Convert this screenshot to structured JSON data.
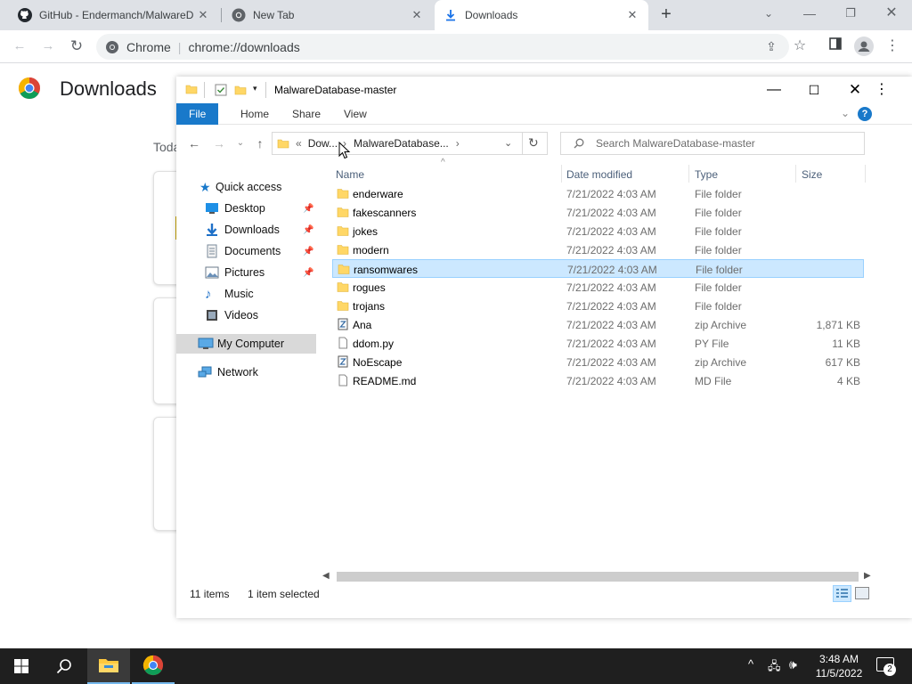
{
  "chrome": {
    "tabs": [
      {
        "title": "GitHub - Endermanch/MalwareD",
        "icon": "github-icon",
        "active": false
      },
      {
        "title": "New Tab",
        "icon": "chrome-icon",
        "active": false
      },
      {
        "title": "Downloads",
        "icon": "download-icon",
        "active": true
      }
    ],
    "omnibox": {
      "site_label": "Chrome",
      "url": "chrome://downloads"
    }
  },
  "downloads_page": {
    "title": "Downloads",
    "today_label": "Toda"
  },
  "explorer": {
    "window_title": "MalwareDatabase-master",
    "ribbon_tabs": {
      "file": "File",
      "home": "Home",
      "share": "Share",
      "view": "View"
    },
    "breadcrumb": {
      "prefix": "«",
      "part1": "Dow...",
      "part2": "MalwareDatabase...",
      "sep": "›"
    },
    "search_placeholder": "Search MalwareDatabase-master",
    "columns": {
      "name": "Name",
      "date": "Date modified",
      "type": "Type",
      "size": "Size"
    },
    "nav": [
      {
        "label": "Quick access",
        "icon": "star-icon"
      },
      {
        "label": "Desktop",
        "icon": "desktop-icon",
        "pinned": true
      },
      {
        "label": "Downloads",
        "icon": "download-arrow-icon",
        "pinned": true
      },
      {
        "label": "Documents",
        "icon": "document-icon",
        "pinned": true
      },
      {
        "label": "Pictures",
        "icon": "picture-icon",
        "pinned": true
      },
      {
        "label": "Music",
        "icon": "music-icon"
      },
      {
        "label": "Videos",
        "icon": "video-icon"
      },
      {
        "label": "My Computer",
        "icon": "computer-icon",
        "selected": true
      },
      {
        "label": "Network",
        "icon": "network-icon"
      }
    ],
    "files": [
      {
        "name": "enderware",
        "date": "7/21/2022 4:03 AM",
        "type": "File folder",
        "size": "",
        "kind": "folder"
      },
      {
        "name": "fakescanners",
        "date": "7/21/2022 4:03 AM",
        "type": "File folder",
        "size": "",
        "kind": "folder"
      },
      {
        "name": "jokes",
        "date": "7/21/2022 4:03 AM",
        "type": "File folder",
        "size": "",
        "kind": "folder"
      },
      {
        "name": "modern",
        "date": "7/21/2022 4:03 AM",
        "type": "File folder",
        "size": "",
        "kind": "folder"
      },
      {
        "name": "ransomwares",
        "date": "7/21/2022 4:03 AM",
        "type": "File folder",
        "size": "",
        "kind": "folder",
        "selected": true
      },
      {
        "name": "rogues",
        "date": "7/21/2022 4:03 AM",
        "type": "File folder",
        "size": "",
        "kind": "folder"
      },
      {
        "name": "trojans",
        "date": "7/21/2022 4:03 AM",
        "type": "File folder",
        "size": "",
        "kind": "folder"
      },
      {
        "name": "Ana",
        "date": "7/21/2022 4:03 AM",
        "type": "zip Archive",
        "size": "1,871 KB",
        "kind": "zip"
      },
      {
        "name": "ddom.py",
        "date": "7/21/2022 4:03 AM",
        "type": "PY File",
        "size": "11 KB",
        "kind": "file"
      },
      {
        "name": "NoEscape",
        "date": "7/21/2022 4:03 AM",
        "type": "zip Archive",
        "size": "617 KB",
        "kind": "zip"
      },
      {
        "name": "README.md",
        "date": "7/21/2022 4:03 AM",
        "type": "MD File",
        "size": "4 KB",
        "kind": "file"
      }
    ],
    "status": {
      "count": "11 items",
      "selection": "1 item selected"
    }
  },
  "taskbar": {
    "time": "3:48 AM",
    "date": "11/5/2022",
    "notification_count": "2"
  },
  "colors": {
    "ribbon_file": "#1979ca",
    "selection": "#cce8ff",
    "folder": "#ffd766",
    "taskbar": "#1f1f1f"
  }
}
